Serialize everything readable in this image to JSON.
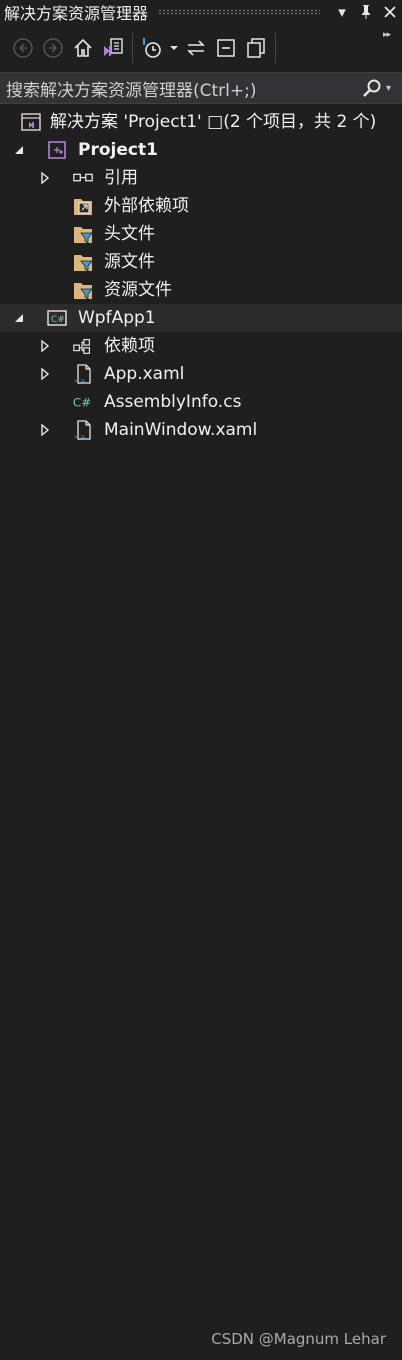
{
  "window": {
    "title": "解决方案资源管理器",
    "buttons": [
      "dropdown-icon",
      "pin-icon",
      "close-icon"
    ]
  },
  "toolbar": {
    "items": [
      "back-icon",
      "forward-icon",
      "home-icon",
      "switch-views-icon",
      "pending-changes-icon",
      "dropdown-icon",
      "sync-icon",
      "collapse-all-icon",
      "show-all-files-icon"
    ],
    "overflow": "▸▸"
  },
  "search": {
    "placeholder": "搜索解决方案资源管理器(Ctrl+;)"
  },
  "tree": {
    "solution": "解决方案 'Project1' □(2 个项目，共 2 个)",
    "project1": {
      "name": "Project1",
      "items": [
        "引用",
        "外部依赖项",
        "头文件",
        "源文件",
        "资源文件"
      ]
    },
    "wpfapp1": {
      "name": "WpfApp1",
      "items": [
        "依赖项",
        "App.xaml",
        "AssemblyInfo.cs",
        "MainWindow.xaml"
      ]
    }
  },
  "watermark": "CSDN @Magnum Lehar",
  "colors": {
    "background": "#1f1f1f",
    "search_bg": "#333337",
    "selected_row": "#2b2b2b",
    "folder": "#dcb67a",
    "filter": "#3c9cdc",
    "vs_purple": "#b180d7",
    "csharp_green": "#7ec699"
  }
}
